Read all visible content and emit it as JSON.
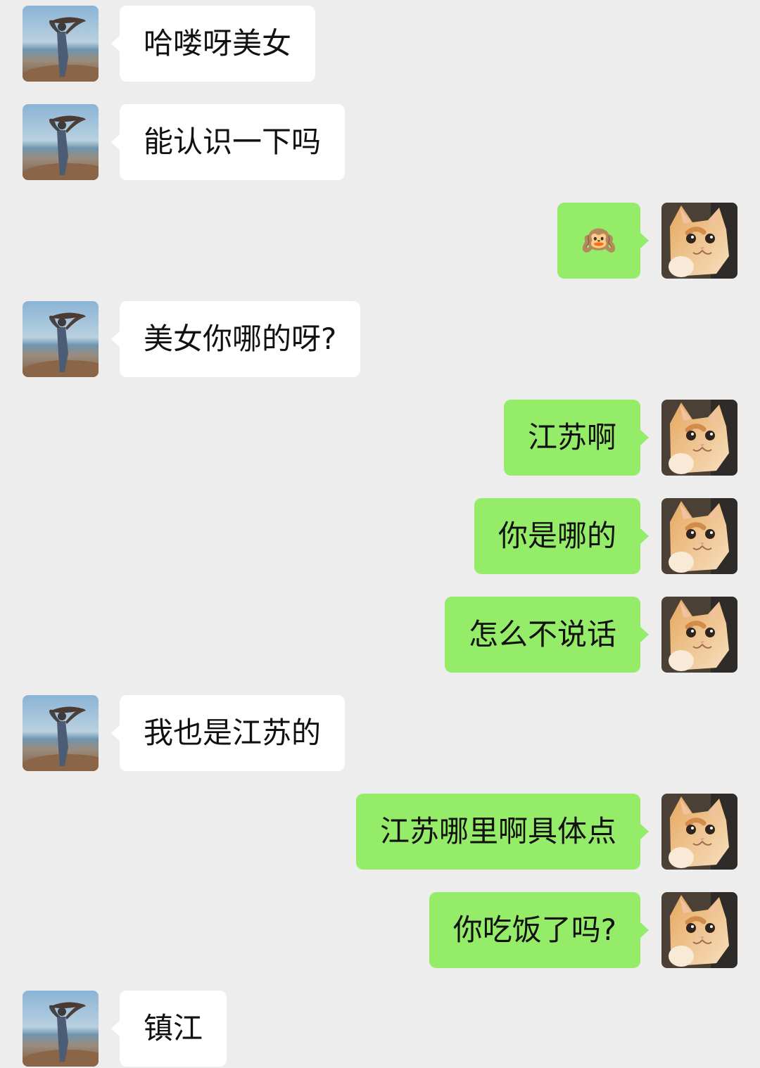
{
  "colors": {
    "background": "#ededed",
    "incoming_bubble": "#ffffff",
    "outgoing_bubble": "#95ec69",
    "text": "#111111"
  },
  "avatars": {
    "other": "beach-person-avatar",
    "self": "orange-cat-avatar"
  },
  "messages": [
    {
      "side": "in",
      "text": "哈喽呀美女"
    },
    {
      "side": "in",
      "text": "能认识一下吗"
    },
    {
      "side": "out",
      "text": "🙉",
      "icon": "hear-no-evil-monkey-icon"
    },
    {
      "side": "in",
      "text": "美女你哪的呀?"
    },
    {
      "side": "out",
      "text": "江苏啊"
    },
    {
      "side": "out",
      "text": "你是哪的"
    },
    {
      "side": "out",
      "text": "怎么不说话"
    },
    {
      "side": "in",
      "text": "我也是江苏的"
    },
    {
      "side": "out",
      "text": "江苏哪里啊具体点"
    },
    {
      "side": "out",
      "text": "你吃饭了吗?"
    },
    {
      "side": "in",
      "text": "镇江"
    }
  ]
}
